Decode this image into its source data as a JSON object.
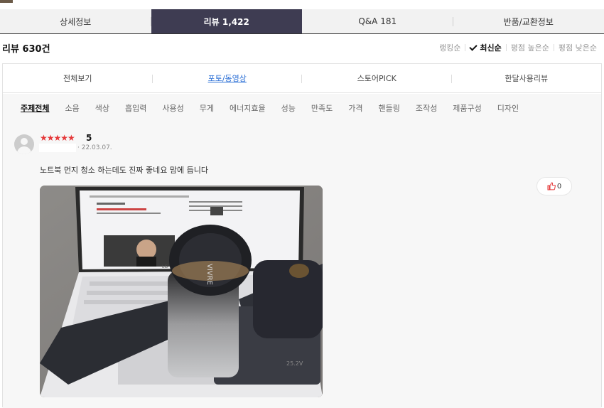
{
  "main_tabs": [
    {
      "label": "상세정보"
    },
    {
      "label": "리뷰 1,422"
    },
    {
      "label": "Q&A 181"
    },
    {
      "label": "반품/교환정보"
    }
  ],
  "review_count": "리뷰 630건",
  "sort_options": [
    {
      "label": "랭킹순"
    },
    {
      "label": "최신순"
    },
    {
      "label": "평점 높은순"
    },
    {
      "label": "평점 낮은순"
    }
  ],
  "filter_tabs": [
    {
      "label": "전체보기"
    },
    {
      "label": "포토/동영상"
    },
    {
      "label": "스토어PICK"
    },
    {
      "label": "한달사용리뷰"
    }
  ],
  "topics": [
    {
      "label": "주제전체"
    },
    {
      "label": "소음"
    },
    {
      "label": "색상"
    },
    {
      "label": "흡입력"
    },
    {
      "label": "사용성"
    },
    {
      "label": "무게"
    },
    {
      "label": "에너지효율"
    },
    {
      "label": "성능"
    },
    {
      "label": "만족도"
    },
    {
      "label": "가격"
    },
    {
      "label": "핸들링"
    },
    {
      "label": "조작성"
    },
    {
      "label": "제품구성"
    },
    {
      "label": "디자인"
    }
  ],
  "review": {
    "stars": "★★★★★",
    "rating": "5",
    "date": "· 22.03.07.",
    "text": "노트북 먼지 청소 하는데도 진짜 좋네요 맘에 듭니다",
    "likes": "0",
    "photo": {
      "brand": "VIVRE",
      "laptop_brand": "LG",
      "battery_label": "25.2V"
    }
  },
  "colors": {
    "active_tab": "#3e3c52",
    "star": "#e5393a",
    "link": "#2b6fd6",
    "like_icon": "#e5393a"
  }
}
